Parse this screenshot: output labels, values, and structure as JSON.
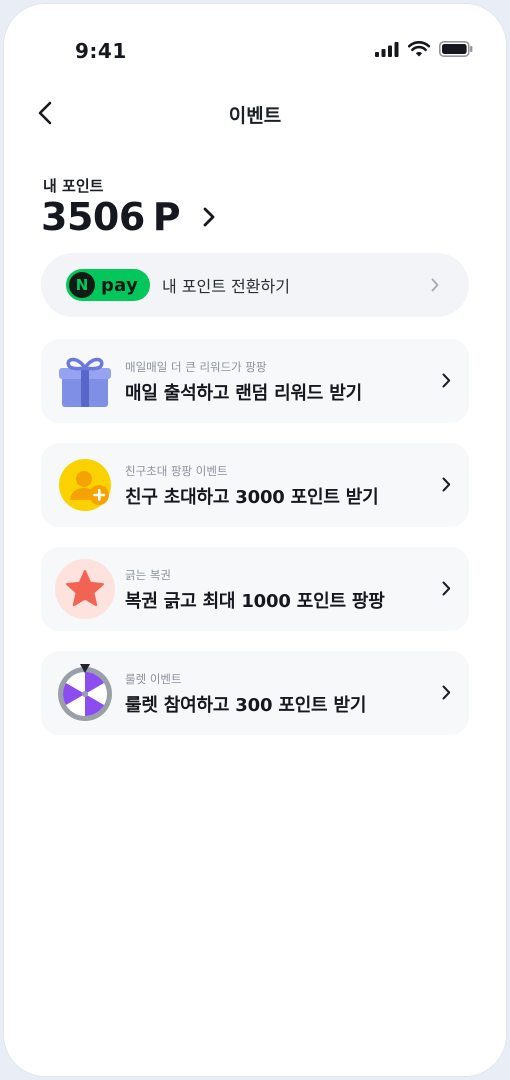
{
  "status_bar": {
    "time": "9:41"
  },
  "nav": {
    "title": "이벤트",
    "back_icon": "chevron-left-icon"
  },
  "points": {
    "label": "내 포인트",
    "value": "3506",
    "unit": "P"
  },
  "npay": {
    "logo_letter": "N",
    "logo_text": "pay",
    "label": "내 포인트 전환하기",
    "brand_color": "#03c75a"
  },
  "events": [
    {
      "icon": "gift-icon",
      "subtitle": "매일매일 더 큰 리워드가 팡팡",
      "title": "매일 출석하고 랜덤 리워드 받기"
    },
    {
      "icon": "invite-friend-icon",
      "subtitle": "친구초대 팡팡 이벤트",
      "title": "친구 초대하고 3000 포인트 받기"
    },
    {
      "icon": "star-icon",
      "subtitle": "긁는 복권",
      "title": "복권 긁고 최대 1000 포인트 팡팡"
    },
    {
      "icon": "roulette-icon",
      "subtitle": "룰렛 이벤트",
      "title": "룰렛 참여하고 300 포인트 받기"
    }
  ]
}
